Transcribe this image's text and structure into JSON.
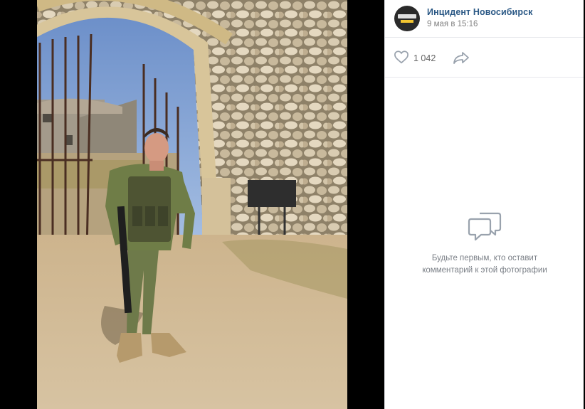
{
  "post": {
    "author": "Инцидент Новосибирск",
    "date": "9 мая в 15:16",
    "likes": "1 042"
  },
  "icons": {
    "like": "heart-icon",
    "share": "share-arrow-icon",
    "comments_empty": "comment-bubbles-icon"
  },
  "comments": {
    "empty_text": "Будьте первым, кто оставит\nкомментарий к этой фотографии"
  },
  "colors": {
    "author_link": "#2a5885",
    "muted": "#828282",
    "icon": "#99a2ad"
  }
}
